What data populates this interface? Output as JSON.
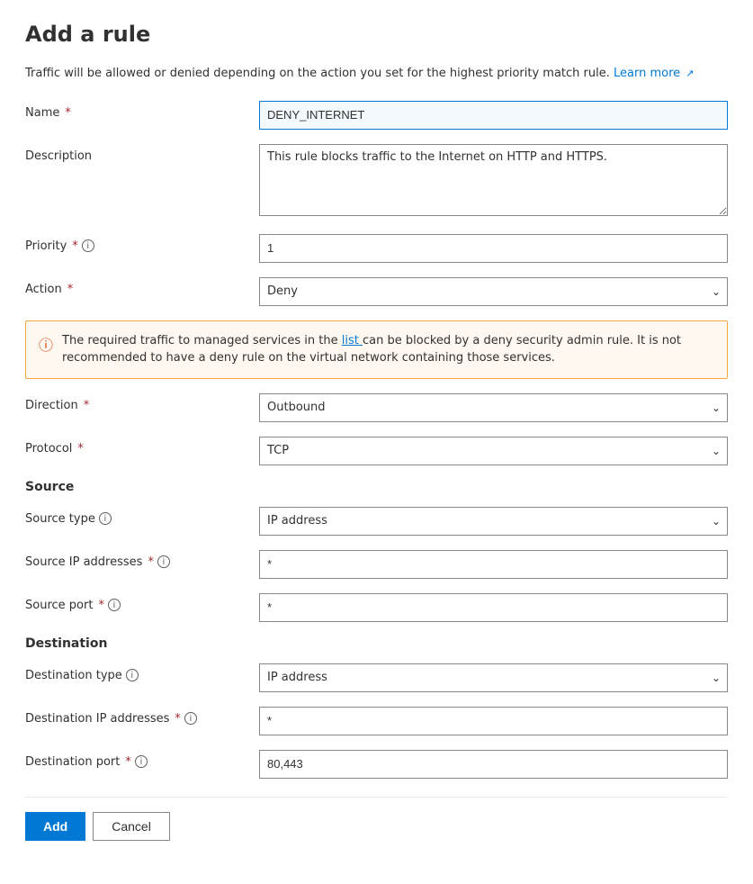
{
  "page": {
    "title": "Add a rule",
    "info_text": "Traffic will be allowed or denied depending on the action you set for the highest priority match rule.",
    "learn_more_label": "Learn more",
    "learn_more_icon": "↗"
  },
  "form": {
    "name_label": "Name",
    "name_required": "*",
    "name_value": "DENY_INTERNET",
    "description_label": "Description",
    "description_value": "This rule blocks traffic to the Internet on HTTP and HTTPS.",
    "priority_label": "Priority",
    "priority_required": "*",
    "priority_value": "1",
    "action_label": "Action",
    "action_required": "*",
    "action_value": "Deny",
    "direction_label": "Direction",
    "direction_required": "*",
    "direction_value": "Outbound",
    "protocol_label": "Protocol",
    "protocol_required": "*",
    "protocol_value": "TCP"
  },
  "warning": {
    "text_before_link": "The required traffic to managed services in the",
    "link_label": "list",
    "text_after_link": "can be blocked by a deny security admin rule. It is not recommended to have a deny rule on the virtual network containing those services."
  },
  "source": {
    "heading": "Source",
    "type_label": "Source type",
    "type_value": "IP address",
    "ip_label": "Source IP addresses",
    "ip_required": "*",
    "ip_value": "*",
    "port_label": "Source port",
    "port_required": "*",
    "port_value": "*"
  },
  "destination": {
    "heading": "Destination",
    "type_label": "Destination type",
    "type_value": "IP address",
    "ip_label": "Destination IP addresses",
    "ip_required": "*",
    "ip_value": "*",
    "port_label": "Destination port",
    "port_required": "*",
    "port_value": "80,443"
  },
  "buttons": {
    "add_label": "Add",
    "cancel_label": "Cancel"
  },
  "icons": {
    "info": "i",
    "chevron": "⌄",
    "warning": "⚠",
    "external_link": "⊿"
  }
}
